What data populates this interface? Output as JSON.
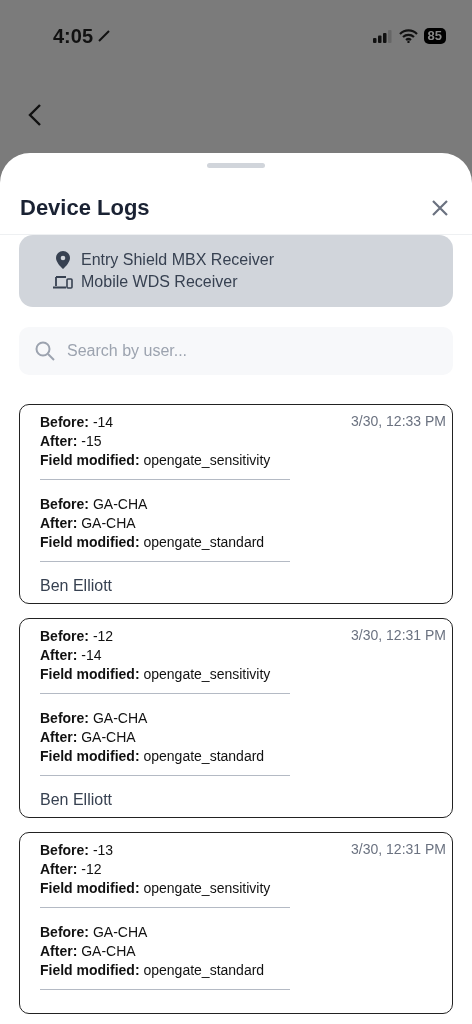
{
  "status_bar": {
    "time": "4:05",
    "battery": "85"
  },
  "sheet": {
    "title": "Device Logs",
    "devices": [
      {
        "kind": "location",
        "name": "Entry Shield MBX Receiver"
      },
      {
        "kind": "device",
        "name": "Mobile WDS Receiver"
      }
    ],
    "search": {
      "placeholder": "Search by user..."
    },
    "logs": [
      {
        "timestamp": "3/30, 12:33 PM",
        "changes": [
          {
            "before": "**Before:** -14",
            "after": "**After:** -15",
            "field": "**Field modified:** opengate_sensitivity"
          },
          {
            "before": "**Before:** GA-CHA",
            "after": "**After:** GA-CHA",
            "field": "**Field modified:** opengate_standard"
          }
        ],
        "user": "Ben Elliott"
      },
      {
        "timestamp": "3/30, 12:31 PM",
        "changes": [
          {
            "before": "**Before:** -12",
            "after": "**After:** -14",
            "field": "**Field modified:** opengate_sensitivity"
          },
          {
            "before": "**Before:** GA-CHA",
            "after": "**After:** GA-CHA",
            "field": "**Field modified:** opengate_standard"
          }
        ],
        "user": "Ben Elliott"
      },
      {
        "timestamp": "3/30, 12:31 PM",
        "changes": [
          {
            "before": "**Before:** -13",
            "after": "**After:** -12",
            "field": "**Field modified:** opengate_sensitivity"
          },
          {
            "before": "**Before:** GA-CHA",
            "after": "**After:** GA-CHA",
            "field": "**Field modified:** opengate_standard"
          }
        ]
      }
    ]
  }
}
